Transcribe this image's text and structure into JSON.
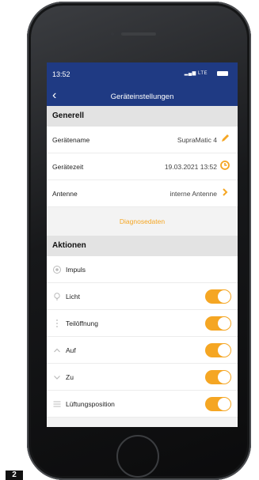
{
  "statusbar": {
    "time": "13:52",
    "network": "LTE"
  },
  "navbar": {
    "back_glyph": "‹",
    "title": "Geräteinstellungen"
  },
  "general": {
    "heading": "Generell",
    "rows": [
      {
        "label": "Gerätename",
        "value": "SupraMatic 4",
        "icon": "pencil-icon"
      },
      {
        "label": "Gerätezeit",
        "value": "19.03.2021 13:52",
        "icon": "clock-icon"
      },
      {
        "label": "Antenne",
        "value": "interne Antenne",
        "icon": "chevron-right-icon"
      }
    ]
  },
  "diagnostics_label": "Diagnosedaten",
  "actions": {
    "heading": "Aktionen",
    "items": [
      {
        "label": "Impuls",
        "icon": "impulse-icon",
        "toggle": false
      },
      {
        "label": "Licht",
        "icon": "bulb-icon",
        "toggle": true,
        "on": true
      },
      {
        "label": "Teilöffnung",
        "icon": "partial-open-icon",
        "toggle": true,
        "on": true
      },
      {
        "label": "Auf",
        "icon": "chevron-up-icon",
        "toggle": true,
        "on": true
      },
      {
        "label": "Zu",
        "icon": "chevron-down-icon",
        "toggle": true,
        "on": true
      },
      {
        "label": "Lüftungsposition",
        "icon": "ventilation-icon",
        "toggle": true,
        "on": true
      }
    ]
  },
  "figure_number": "2",
  "colors": {
    "nav": "#1f3a83",
    "accent": "#f5a623"
  }
}
